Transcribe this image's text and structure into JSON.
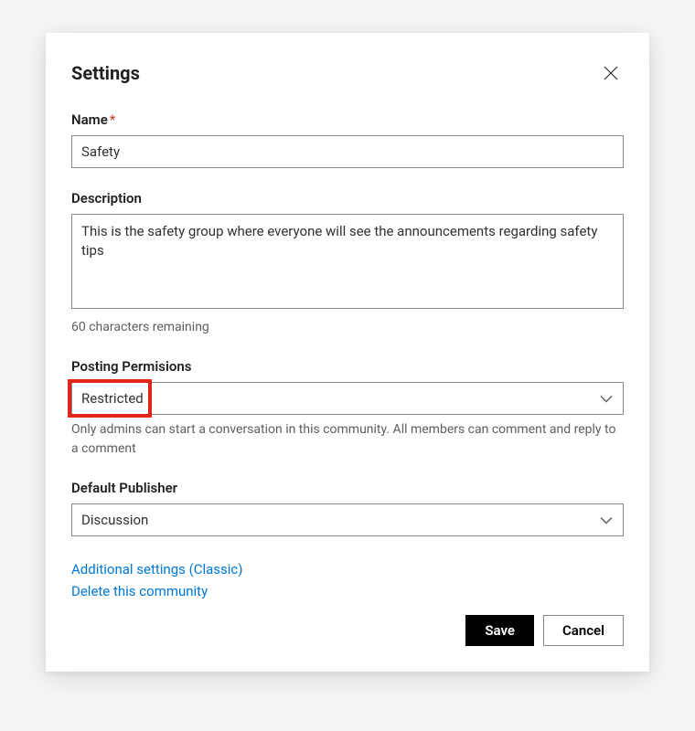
{
  "header": {
    "title": "Settings"
  },
  "fields": {
    "name": {
      "label": "Name",
      "required_mark": "*",
      "value": "Safety"
    },
    "description": {
      "label": "Description",
      "value": "This is the safety group where everyone will see the announcements regarding safety tips",
      "remaining_text": "60 characters remaining"
    },
    "posting_permissions": {
      "label": "Posting Permisions",
      "value": "Restricted",
      "helper": "Only admins can start a conversation in this community. All members can comment and reply to a comment"
    },
    "default_publisher": {
      "label": "Default Publisher",
      "value": "Discussion"
    }
  },
  "links": {
    "additional": "Additional settings (Classic)",
    "delete": "Delete this community"
  },
  "footer": {
    "save": "Save",
    "cancel": "Cancel"
  }
}
